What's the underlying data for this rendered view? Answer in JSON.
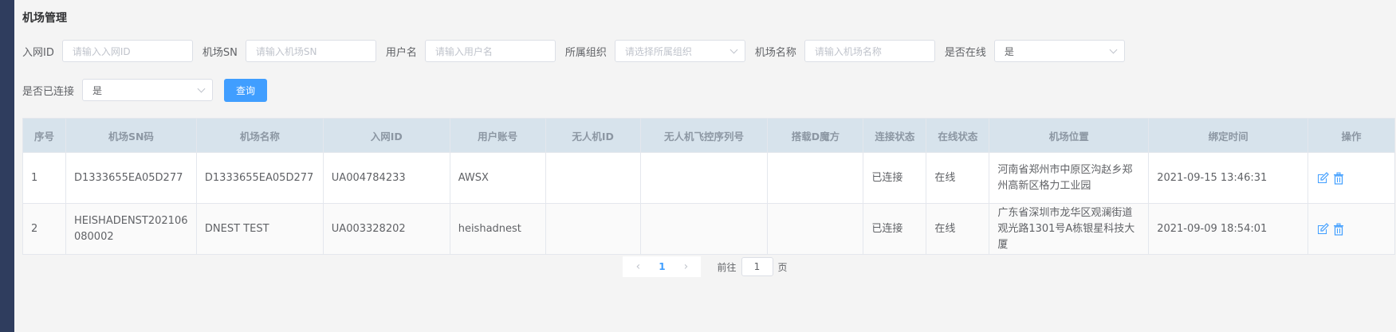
{
  "page": {
    "title": "机场管理"
  },
  "filters": {
    "network_id": {
      "label": "入网ID",
      "placeholder": "请输入入网ID"
    },
    "airport_sn": {
      "label": "机场SN",
      "placeholder": "请输入机场SN"
    },
    "username": {
      "label": "用户名",
      "placeholder": "请输入用户名"
    },
    "org": {
      "label": "所属组织",
      "placeholder": "请选择所属组织"
    },
    "airport_name": {
      "label": "机场名称",
      "placeholder": "请输入机场名称"
    },
    "online": {
      "label": "是否在线",
      "value": "是"
    },
    "connected": {
      "label": "是否已连接",
      "value": "是"
    },
    "query_label": "查询"
  },
  "table": {
    "headers": [
      "序号",
      "机场SN码",
      "机场名称",
      "入网ID",
      "用户账号",
      "无人机ID",
      "无人机飞控序列号",
      "搭载D魔方",
      "连接状态",
      "在线状态",
      "机场位置",
      "绑定时间",
      "操作"
    ],
    "rows": [
      {
        "index": "1",
        "sn": "D1333655EA05D277",
        "name": "D1333655EA05D277",
        "network_id": "UA004784233",
        "account": "AWSX",
        "drone_id": "",
        "fc_serial": "",
        "dcube": "",
        "conn_status": "已连接",
        "online_status": "在线",
        "location": "河南省郑州市中原区沟赵乡郑州高新区格力工业园",
        "bind_time": "2021-09-15 13:46:31"
      },
      {
        "index": "2",
        "sn": "HEISHADENST202106080002",
        "name": "DNEST TEST",
        "network_id": "UA003328202",
        "account": "heishadnest",
        "drone_id": "",
        "fc_serial": "",
        "dcube": "",
        "conn_status": "已连接",
        "online_status": "在线",
        "location": "广东省深圳市龙华区观澜街道观光路1301号A栋银星科技大厦",
        "bind_time": "2021-09-09 18:54:01"
      }
    ]
  },
  "pagination": {
    "current_page": "1",
    "goto_prefix": "前往",
    "goto_value": "1",
    "goto_suffix": "页"
  },
  "icons": {
    "edit": "edit-icon",
    "delete": "delete-icon",
    "prev": "chevron-left-icon",
    "next": "chevron-right-icon"
  },
  "colors": {
    "accent": "#409eff",
    "sidebar": "#2f3d5e",
    "header_bg": "#d7e3ec"
  }
}
